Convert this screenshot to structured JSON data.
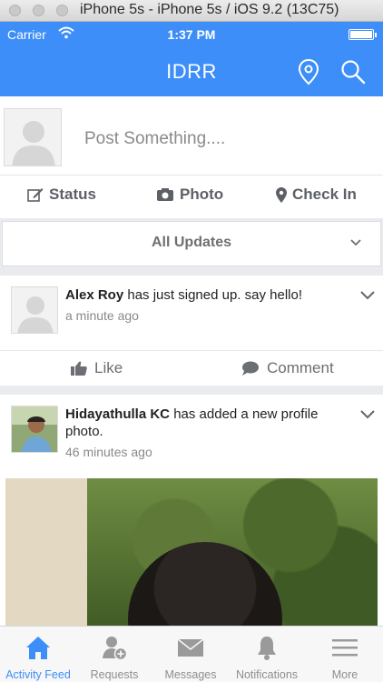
{
  "window": {
    "title": "iPhone 5s - iPhone 5s / iOS 9.2 (13C75)"
  },
  "status_bar": {
    "carrier": "Carrier",
    "time": "1:37 PM"
  },
  "nav": {
    "title": "IDRR",
    "icons": [
      "location-pin-icon",
      "search-icon"
    ]
  },
  "composer": {
    "placeholder": "Post Something....",
    "actions": [
      {
        "label": "Status",
        "icon": "edit-icon"
      },
      {
        "label": "Photo",
        "icon": "camera-icon"
      },
      {
        "label": "Check In",
        "icon": "map-marker-icon"
      }
    ]
  },
  "filter": {
    "label": "All Updates"
  },
  "feed": [
    {
      "user": "Alex Roy",
      "message": " has just signed up. say hello!",
      "time": "a minute ago",
      "like_label": "Like",
      "comment_label": "Comment"
    },
    {
      "user": "Hidayathulla KC",
      "message": " has added a new profile photo.",
      "time": "46 minutes ago"
    }
  ],
  "tabbar": {
    "items": [
      {
        "label": "Activity Feed",
        "icon": "home-icon",
        "active": true
      },
      {
        "label": "Requests",
        "icon": "add-user-icon",
        "active": false
      },
      {
        "label": "Messages",
        "icon": "envelope-icon",
        "active": false
      },
      {
        "label": "Notifications",
        "icon": "bell-icon",
        "active": false
      },
      {
        "label": "More",
        "icon": "menu-icon",
        "active": false
      }
    ]
  },
  "colors": {
    "brand_blue": "#3d8ef8",
    "background": "#e9ebee",
    "muted_text": "#8a8a8a"
  }
}
